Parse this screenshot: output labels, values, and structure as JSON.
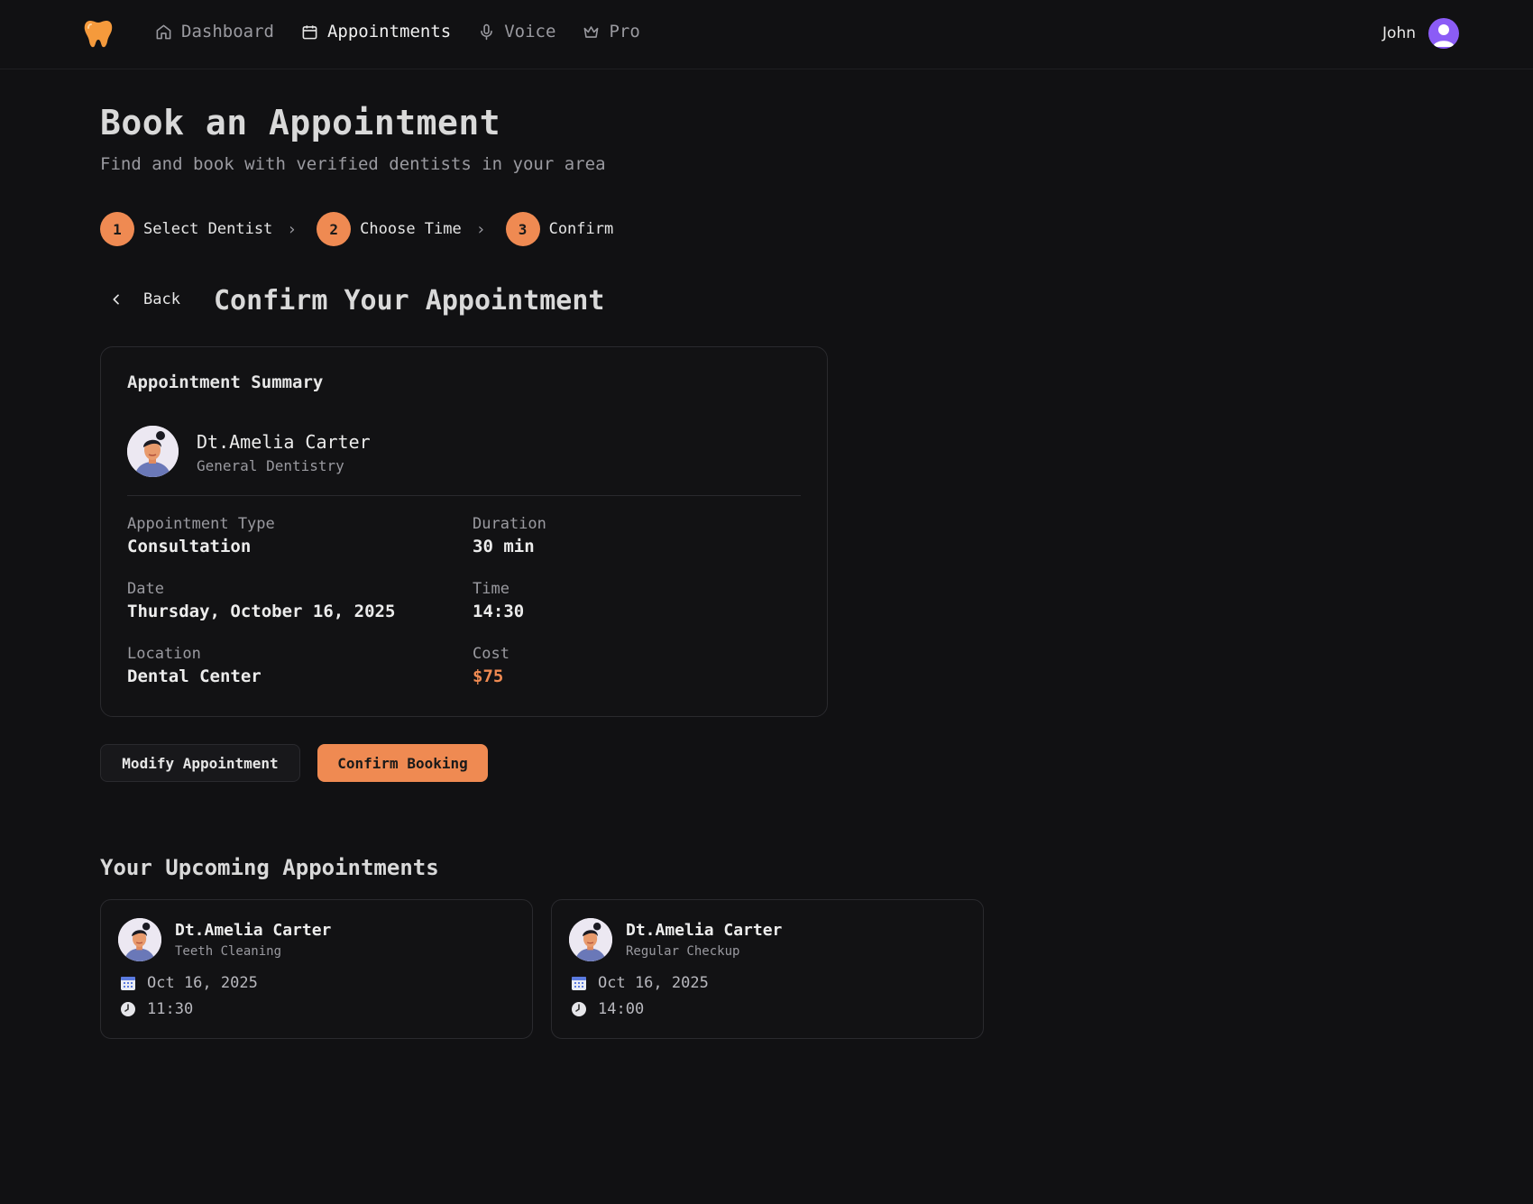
{
  "nav": {
    "links": [
      {
        "label": "Dashboard",
        "icon": "home-icon",
        "active": false
      },
      {
        "label": "Appointments",
        "icon": "calendar-icon",
        "active": true
      },
      {
        "label": "Voice",
        "icon": "microphone-icon",
        "active": false
      },
      {
        "label": "Pro",
        "icon": "crown-icon",
        "active": false
      }
    ],
    "user_name": "John"
  },
  "header": {
    "title": "Book an Appointment",
    "subtitle": "Find and book with verified dentists in your area"
  },
  "stepper": {
    "steps": [
      {
        "number": "1",
        "label": "Select Dentist"
      },
      {
        "number": "2",
        "label": "Choose Time"
      },
      {
        "number": "3",
        "label": "Confirm"
      }
    ]
  },
  "confirm": {
    "back_label": "Back",
    "title": "Confirm Your Appointment"
  },
  "summary": {
    "title": "Appointment Summary",
    "doctor_name": "Dt.Amelia Carter",
    "specialty": "General Dentistry",
    "fields": {
      "type": {
        "label": "Appointment Type",
        "value": "Consultation"
      },
      "duration": {
        "label": "Duration",
        "value": "30 min"
      },
      "date": {
        "label": "Date",
        "value": "Thursday, October 16, 2025"
      },
      "time": {
        "label": "Time",
        "value": "14:30"
      },
      "location": {
        "label": "Location",
        "value": "Dental Center"
      },
      "cost": {
        "label": "Cost",
        "value": "$75"
      }
    }
  },
  "actions": {
    "modify_label": "Modify Appointment",
    "confirm_label": "Confirm Booking"
  },
  "upcoming": {
    "title": "Your Upcoming Appointments",
    "items": [
      {
        "doctor": "Dt.Amelia Carter",
        "type": "Teeth Cleaning",
        "date": "Oct 16, 2025",
        "time": "11:30"
      },
      {
        "doctor": "Dt.Amelia Carter",
        "type": "Regular Checkup",
        "date": "Oct 16, 2025",
        "time": "14:00"
      }
    ]
  },
  "colors": {
    "background": "#111113",
    "accent": "#ef8a52",
    "user_avatar": "#8b5cf6"
  }
}
